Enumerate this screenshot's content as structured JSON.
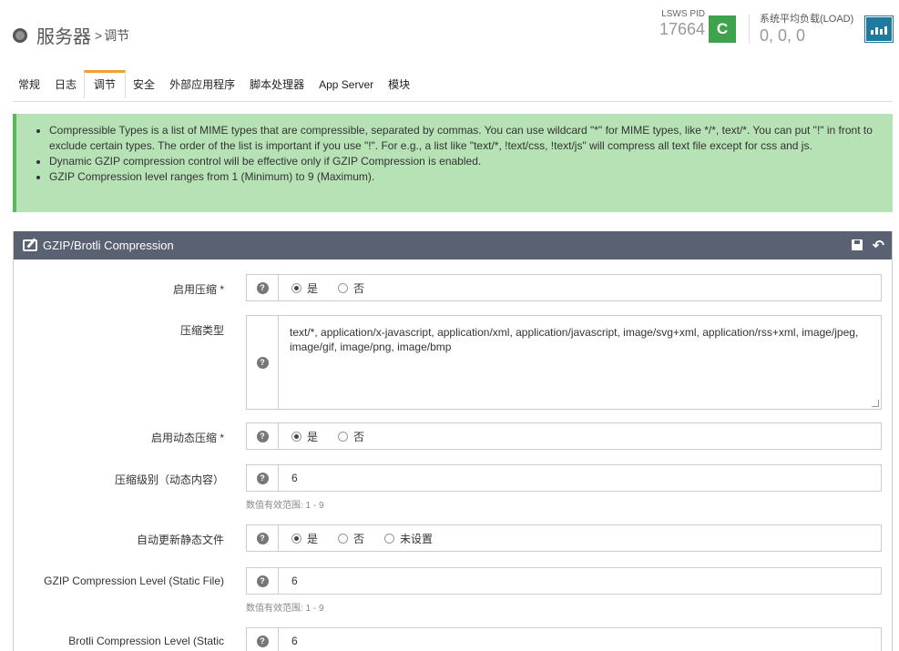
{
  "header": {
    "title": "服务器",
    "separator": ">",
    "subtitle": "调节",
    "pid_label": "LSWS PID",
    "pid_value": "17664",
    "reload_glyph": "C",
    "load_label": "系统平均负载(LOAD)",
    "load_value": "0, 0, 0"
  },
  "tabs": [
    {
      "label": "常规"
    },
    {
      "label": "日志"
    },
    {
      "label": "调节",
      "active": true
    },
    {
      "label": "安全"
    },
    {
      "label": "外部应用程序"
    },
    {
      "label": "脚本处理器"
    },
    {
      "label": "App Server"
    },
    {
      "label": "模块"
    }
  ],
  "info": {
    "items": [
      "Compressible Types is a list of MIME types that are compressible, separated by commas. You can use wildcard \"*\" for MIME types, like */*, text/*. You can put \"!\" in front to exclude certain types. The order of the list is important if you use \"!\". For e.g., a list like \"text/*, !text/css, !text/js\" will compress all text file except for css and js.",
      "Dynamic GZIP compression control will be effective only if GZIP Compression is enabled.",
      "GZIP Compression level ranges from 1 (Minimum) to 9 (Maximum)."
    ]
  },
  "panel": {
    "title": "GZIP/Brotli Compression",
    "help_glyph": "?",
    "fields": {
      "enable_compression": {
        "label": "启用压缩 *",
        "yes": "是",
        "no": "否"
      },
      "compressible_types": {
        "label": "压缩类型",
        "value": "text/*, application/x-javascript, application/xml, application/javascript, image/svg+xml, application/rss+xml, image/jpeg, image/gif, image/png, image/bmp"
      },
      "enable_dynamic": {
        "label": "启用动态压缩 *",
        "yes": "是",
        "no": "否"
      },
      "gzip_dynamic_level": {
        "label": "压缩级别（动态内容）",
        "value": "6",
        "hint": "数值有效范围: 1 - 9"
      },
      "auto_update_static": {
        "label": "自动更新静态文件",
        "yes": "是",
        "no": "否",
        "unset": "未设置"
      },
      "gzip_static_level": {
        "label": "GZIP Compression Level (Static File)",
        "value": "6",
        "hint": "数值有效范围: 1 - 9"
      },
      "brotli_static_level": {
        "label": "Brotli Compression Level (Static",
        "value": "6"
      }
    }
  }
}
